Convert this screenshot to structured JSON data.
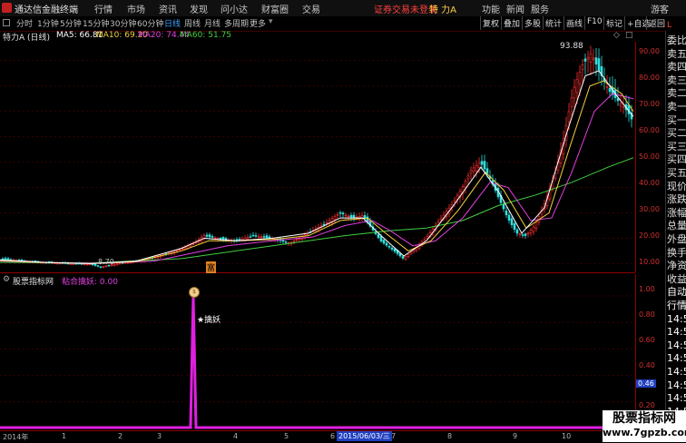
{
  "app": {
    "title": "通达信金融终端",
    "menu": [
      "行情",
      "市场",
      "资讯",
      "发现",
      "问小达",
      "财富圈",
      "交易"
    ],
    "login_status": "证券交易未登录",
    "stock_tab": "特 力A",
    "right_menu": [
      "功能",
      "新闻",
      "服务",
      "游客"
    ]
  },
  "toolbar": {
    "periods": [
      "分时",
      "1分钟",
      "5分钟",
      "15分钟",
      "30分钟",
      "60分钟",
      "日线",
      "周线",
      "月线",
      "多周期",
      "更多"
    ],
    "active_period": "日线",
    "right_buttons": [
      "复权",
      "叠加",
      "多股",
      "统计",
      "画线",
      "F10",
      "标记",
      "+自选",
      "返回"
    ]
  },
  "main_chart": {
    "stock_label": "特力A (日线)",
    "ma": [
      {
        "label": "MA5: 66.81",
        "color": "#ffffff"
      },
      {
        "label": "MA10: 69.20",
        "color": "#f0d040"
      },
      {
        "label": "MA20: 74.44",
        "color": "#e040e0"
      },
      {
        "label": "MA60: 51.75",
        "color": "#40d040"
      }
    ],
    "high_label": "93.88",
    "low_label": "8.70",
    "marker_char": "富",
    "y_ticks": [
      "90.00",
      "80.00",
      "70.00",
      "60.00",
      "50.00",
      "40.00",
      "30.00",
      "20.00",
      "10.00"
    ]
  },
  "indicator": {
    "name": "股票指标网",
    "formula": "粘合擒妖: 0.00",
    "signal_label": "★擒妖",
    "signal_icon": "money-bag",
    "y_ticks": [
      "1.00",
      "0.80",
      "0.60",
      "0.40",
      "0.20"
    ],
    "current_value": "0.46"
  },
  "time_axis": {
    "year_label": "2014年",
    "months": [
      "1",
      "2",
      "3",
      "4",
      "5",
      "6",
      "7",
      "8",
      "9",
      "10"
    ],
    "cursor_date": "2015/06/03/三"
  },
  "side_panel": {
    "badge": "L",
    "items": [
      "委比",
      "卖五",
      "卖四",
      "卖三",
      "卖二",
      "卖一",
      "买一",
      "买二",
      "买三",
      "买四",
      "买五",
      "现价",
      "涨跌",
      "涨幅",
      "总量",
      "外盘",
      "换手",
      "净资",
      "收益",
      "自动",
      "行情",
      "14:5",
      "14:5",
      "14:5",
      "14:5",
      "14:5",
      "14:5",
      "14:5",
      "14:5",
      "14:5"
    ]
  },
  "watermark": {
    "line1": "股票指标网",
    "line2": "www.7gpzb.com"
  },
  "chart_data": {
    "type": "candlestick",
    "x_range": [
      "2014-01",
      "2015-12"
    ],
    "ylim": [
      8,
      96
    ],
    "series": [
      {
        "name": "MA5",
        "color": "#ffffff"
      },
      {
        "name": "MA10",
        "color": "#f0d040"
      },
      {
        "name": "MA20",
        "color": "#e040e0"
      },
      {
        "name": "MA60",
        "color": "#40d040"
      }
    ],
    "close_path": [
      [
        0,
        12
      ],
      [
        25,
        11
      ],
      [
        50,
        10.5
      ],
      [
        75,
        10
      ],
      [
        100,
        9.8
      ],
      [
        112,
        8.7
      ],
      [
        130,
        10
      ],
      [
        155,
        11
      ],
      [
        175,
        13
      ],
      [
        195,
        15
      ],
      [
        215,
        18
      ],
      [
        225,
        21
      ],
      [
        240,
        20
      ],
      [
        260,
        19
      ],
      [
        280,
        21
      ],
      [
        300,
        20
      ],
      [
        320,
        18
      ],
      [
        340,
        22
      ],
      [
        360,
        26
      ],
      [
        375,
        30
      ],
      [
        390,
        28
      ],
      [
        400,
        29
      ],
      [
        410,
        24
      ],
      [
        420,
        19
      ],
      [
        435,
        15
      ],
      [
        445,
        12
      ],
      [
        455,
        15
      ],
      [
        470,
        20
      ],
      [
        485,
        27
      ],
      [
        500,
        34
      ],
      [
        510,
        40
      ],
      [
        520,
        47
      ],
      [
        530,
        50
      ],
      [
        540,
        44
      ],
      [
        550,
        36
      ],
      [
        560,
        28
      ],
      [
        570,
        22
      ],
      [
        580,
        21
      ],
      [
        590,
        25
      ],
      [
        600,
        33
      ],
      [
        612,
        45
      ],
      [
        622,
        60
      ],
      [
        632,
        78
      ],
      [
        642,
        88
      ],
      [
        652,
        93
      ],
      [
        662,
        85
      ],
      [
        672,
        78
      ],
      [
        682,
        74
      ],
      [
        692,
        70
      ],
      [
        698,
        66
      ]
    ],
    "ma5_path": [
      [
        0,
        11.5
      ],
      [
        50,
        10.5
      ],
      [
        100,
        10
      ],
      [
        150,
        11
      ],
      [
        200,
        16
      ],
      [
        225,
        20
      ],
      [
        260,
        19
      ],
      [
        300,
        20
      ],
      [
        340,
        22
      ],
      [
        375,
        28
      ],
      [
        400,
        28
      ],
      [
        420,
        21
      ],
      [
        445,
        13
      ],
      [
        470,
        19
      ],
      [
        500,
        33
      ],
      [
        530,
        48
      ],
      [
        550,
        38
      ],
      [
        575,
        22
      ],
      [
        600,
        32
      ],
      [
        625,
        62
      ],
      [
        645,
        84
      ],
      [
        660,
        86
      ],
      [
        680,
        76
      ],
      [
        698,
        68
      ]
    ],
    "ma10_path": [
      [
        0,
        11.2
      ],
      [
        50,
        10.4
      ],
      [
        100,
        10
      ],
      [
        150,
        10.8
      ],
      [
        200,
        15
      ],
      [
        230,
        19
      ],
      [
        260,
        19
      ],
      [
        300,
        19.5
      ],
      [
        340,
        21
      ],
      [
        375,
        27
      ],
      [
        405,
        28
      ],
      [
        425,
        22
      ],
      [
        450,
        15
      ],
      [
        475,
        19
      ],
      [
        505,
        31
      ],
      [
        535,
        46
      ],
      [
        555,
        39
      ],
      [
        580,
        24
      ],
      [
        605,
        30
      ],
      [
        628,
        56
      ],
      [
        650,
        80
      ],
      [
        665,
        82
      ],
      [
        685,
        77
      ],
      [
        698,
        70
      ]
    ],
    "ma20_path": [
      [
        0,
        11
      ],
      [
        60,
        10.3
      ],
      [
        120,
        10.2
      ],
      [
        170,
        11
      ],
      [
        210,
        14
      ],
      [
        250,
        17
      ],
      [
        300,
        19
      ],
      [
        345,
        20.5
      ],
      [
        380,
        25
      ],
      [
        410,
        27
      ],
      [
        430,
        23
      ],
      [
        455,
        17
      ],
      [
        480,
        19
      ],
      [
        510,
        28
      ],
      [
        540,
        42
      ],
      [
        560,
        40
      ],
      [
        585,
        27
      ],
      [
        608,
        28
      ],
      [
        630,
        46
      ],
      [
        655,
        70
      ],
      [
        675,
        77
      ],
      [
        698,
        75
      ]
    ],
    "ma60_path": [
      [
        0,
        10.5
      ],
      [
        100,
        10.2
      ],
      [
        200,
        12
      ],
      [
        260,
        15
      ],
      [
        320,
        18
      ],
      [
        380,
        21
      ],
      [
        430,
        23
      ],
      [
        470,
        24
      ],
      [
        510,
        27
      ],
      [
        550,
        33
      ],
      [
        590,
        37
      ],
      [
        630,
        42
      ],
      [
        670,
        48
      ],
      [
        698,
        51.75
      ]
    ],
    "indicator_signal": {
      "date": "2015-03",
      "value": 1.0
    }
  }
}
